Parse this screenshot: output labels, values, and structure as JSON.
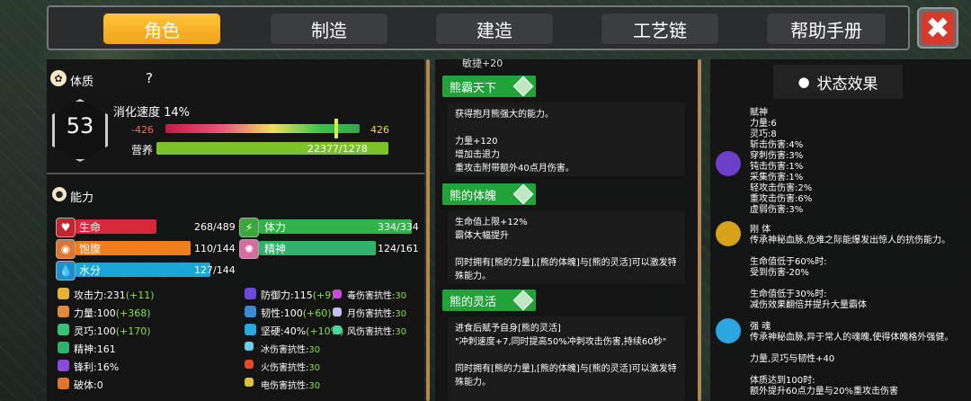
{
  "tabs": [
    {
      "label": "角色",
      "active": true
    },
    {
      "label": "制造",
      "active": false
    },
    {
      "label": "建造",
      "active": false
    },
    {
      "label": "工艺链",
      "active": false
    },
    {
      "label": "帮助手册",
      "active": false
    }
  ],
  "close": {
    "icon": "close-icon",
    "label": "✖"
  },
  "constitution": {
    "title": "体质",
    "help": "?",
    "level": "53",
    "digest_label": "消化速度 14%",
    "range_min": "-426",
    "range_max": "426",
    "nutrition_label": "营养",
    "nutrition_value": "22377/1278"
  },
  "ability": {
    "title": "能力",
    "vitals": [
      {
        "label": "生命",
        "value": "268/489",
        "fill": 0.55,
        "color": "#d8283b"
      },
      {
        "label": "饱腹",
        "value": "110/144",
        "fill": 0.76,
        "color": "#f07e1c"
      },
      {
        "label": "水分",
        "value": "127/144",
        "fill": 0.88,
        "color": "#1aa6d6"
      }
    ],
    "vitals2": [
      {
        "label": "体力",
        "value": "334/334",
        "fill": 1.0,
        "color": "#32b34a"
      },
      {
        "label": "精神",
        "value": "124/161",
        "fill": 0.77,
        "color": "#2fb36b"
      }
    ],
    "stats_left": [
      {
        "label": "攻击力:231",
        "bonus": "(+11)"
      },
      {
        "label": "力量:100",
        "bonus": "(+368)"
      },
      {
        "label": "灵巧:100",
        "bonus": "(+170)"
      },
      {
        "label": "精神:161",
        "bonus": ""
      },
      {
        "label": "锋利:16%",
        "bonus": ""
      },
      {
        "label": "破体:0",
        "bonus": ""
      }
    ],
    "stats_mid": [
      {
        "label": "防御力:115",
        "bonus": "(+9)"
      },
      {
        "label": "韧性:100",
        "bonus": "(+60)"
      },
      {
        "label": "坚硬:40%",
        "bonus": "(+10%)"
      },
      {
        "label": "冰伤害抗性:",
        "bonus": "30"
      },
      {
        "label": "火伤害抗性:",
        "bonus": "30"
      },
      {
        "label": "电伤害抗性:",
        "bonus": "30"
      }
    ],
    "stats_right": [
      {
        "label": "毒伤害抗性:",
        "bonus": "30"
      },
      {
        "label": "月伤害抗性:",
        "bonus": "30"
      },
      {
        "label": "风伤害抗性:",
        "bonus": "30"
      }
    ]
  },
  "skills": [
    {
      "name": "熊霸天下",
      "desc": "获得抱月熊强大的能力。\n\n力量+120\n增加击退力\n重攻击附带额外40点月伤害。"
    },
    {
      "name": "熊的体魄",
      "desc": "生命值上限+12%\n霸体大幅提升\n\n同时拥有[熊的力量],[熊的体魄]与[熊的灵活]可以激发特殊能力。"
    },
    {
      "name": "熊的灵活",
      "desc": "进食后赋予自身[熊的灵活]\n\"冲刺速度+7,同时提高50%冲刺攻击伤害,持续60秒\"\n\n同时拥有[熊的力量],[熊的体魄]与[熊的灵活]可以激发特殊能力。"
    }
  ],
  "skill_top_cut": "敏捷+20",
  "effects": {
    "title": "状态效果",
    "items": [
      {
        "text": "赋神\n力量:6\n灵巧:8\n斩击伤害:4%\n穿刺伤害:3%\n钝击伤害:1%\n采集伤害:1%\n轻攻击伤害:2%\n重攻击伤害:6%\n虚弱伤害:3%",
        "color": "#6b3fc9"
      },
      {
        "text": "刚 体\n传承神秘血脉,危难之际能爆发出惊人的抗伤能力。\n\n生命值低于60%时:\n受到伤害-20%\n\n生命值低于30%时:\n减伤效果翻倍并提升大量霸体",
        "color": "#d6a21a"
      },
      {
        "text": "强 魂\n传承神秘血脉,异于常人的魂魄,使得体魄格外强健。\n\n力量,灵巧与韧性+40\n\n体质达到100时:\n额外提升60点力量与20%重攻击伤害",
        "color": "#2aa6e0"
      }
    ]
  }
}
